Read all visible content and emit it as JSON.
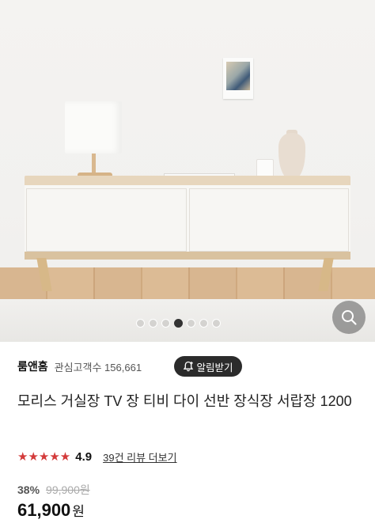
{
  "gallery": {
    "slide_count": 7,
    "active_index": 3,
    "search_icon": "search-icon"
  },
  "shop": {
    "brand": "룸앤홈",
    "fans_label": "관심고객수 156,661",
    "follow_label": "알림받기",
    "follow_icon": "bell-plus-icon"
  },
  "product": {
    "title": "모리스 거실장 TV 장 티비 다이 선반 장식장 서랍장 1200"
  },
  "rating": {
    "stars": "★★★★★",
    "score": "4.9",
    "reviews_label": "39건 리뷰 더보기",
    "star_color": "#d33a3a"
  },
  "price": {
    "discount": "38%",
    "original": "99,900원",
    "amount": "61,900",
    "unit": "원"
  }
}
